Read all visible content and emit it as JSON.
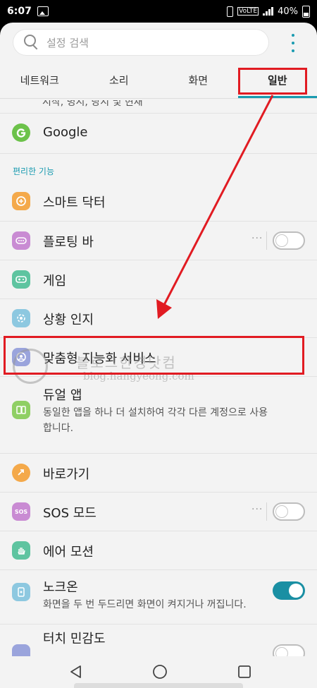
{
  "status": {
    "time": "6:07",
    "battery": "40%"
  },
  "search": {
    "placeholder": "설정 검색"
  },
  "tabs": [
    {
      "label": "네트워크"
    },
    {
      "label": "소리"
    },
    {
      "label": "화면"
    },
    {
      "label": "일반",
      "active": true
    }
  ],
  "cut_row": "시작, 명시, 당시 및 현재",
  "items": {
    "google": {
      "title": "Google"
    },
    "section_label": "편리한 기능",
    "smart_doctor": {
      "title": "스마트 닥터"
    },
    "floating_bar": {
      "title": "플로팅 바",
      "toggle": false
    },
    "game": {
      "title": "게임"
    },
    "context": {
      "title": "상황 인지"
    },
    "custom_ai": {
      "title": "맞춤형 지능화 서비스"
    },
    "dual_app": {
      "title": "듀얼 앱",
      "subtitle": "동일한 앱을 하나 더 설치하여 각각 다른 계정으로 사용합니다."
    },
    "shortcut": {
      "title": "바로가기"
    },
    "sos": {
      "title": "SOS 모드",
      "toggle": false
    },
    "air_motion": {
      "title": "에어 모션"
    },
    "knock_on": {
      "title": "노크온",
      "subtitle": "화면을 두 번 두드리면 화면이 켜지거나 꺼집니다.",
      "toggle": true
    },
    "touch": {
      "title": "터치 민감도",
      "toggle": false
    }
  },
  "watermark": {
    "kr": "블로그한경닷컴",
    "en": "blog.hangyeong.com"
  },
  "colors": {
    "accent": "#1a9bb0",
    "highlight": "#e11b22"
  }
}
